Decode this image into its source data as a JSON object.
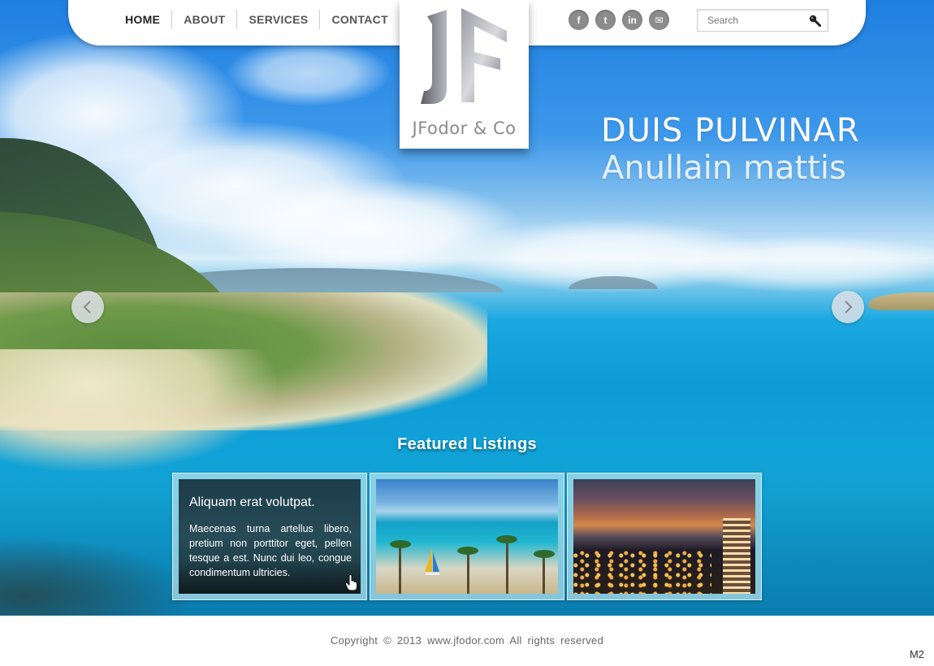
{
  "nav": {
    "items": [
      {
        "label": "HOME",
        "active": true
      },
      {
        "label": "ABOUT",
        "active": false
      },
      {
        "label": "SERVICES",
        "active": false
      },
      {
        "label": "CONTACT",
        "active": false
      }
    ]
  },
  "social": {
    "icons": [
      "facebook-icon",
      "twitter-icon",
      "linkedin-icon",
      "email-icon"
    ],
    "glyphs": [
      "f",
      "t",
      "in",
      "✉"
    ]
  },
  "search": {
    "placeholder": "Search",
    "value": ""
  },
  "logo": {
    "monogram": "JF",
    "name": "JFodor & Co"
  },
  "hero": {
    "headline": "DUIS PULVINAR",
    "subheadline": "Anullain mattis",
    "prev_glyph": "‹",
    "next_glyph": "›"
  },
  "featured": {
    "title": "Featured Listings",
    "cards": [
      {
        "title": "Aliquam erat volutpat.",
        "text": "Maecenas turna artellus libero, pretium non porttitor eget, pellen tesque a est. Nunc dui leo, congue condimentum ultricies."
      },
      {
        "title": "",
        "text": ""
      },
      {
        "title": "",
        "text": ""
      }
    ]
  },
  "footer": {
    "copyright": "Copyright © 2013 www.jfodor.com All rights reserved",
    "mark": "M2"
  },
  "colors": {
    "accent": "#1aa8e0",
    "nav_text": "#555555",
    "icon_gray": "#8c8c8c"
  }
}
